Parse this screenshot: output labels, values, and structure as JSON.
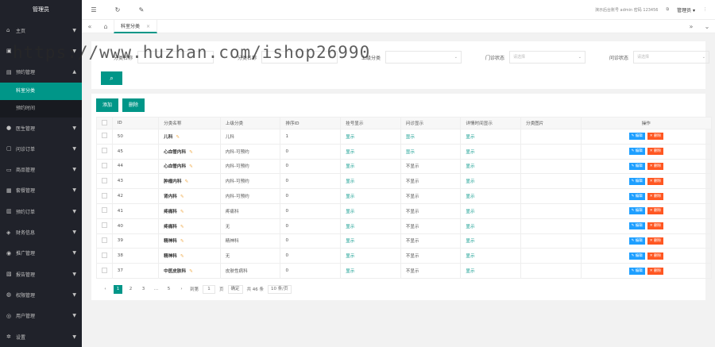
{
  "sidebar": {
    "logo": "管理员",
    "items": [
      {
        "label": "主页",
        "icon": "home-icon"
      },
      {
        "label": "",
        "icon": "app-icon"
      },
      {
        "label": "预约管理",
        "icon": "doc-icon",
        "expanded": true,
        "sub": [
          {
            "label": "科室分类",
            "active": true
          },
          {
            "label": "预约时间",
            "active": false
          }
        ]
      },
      {
        "label": "医生管理",
        "icon": "user-icon"
      },
      {
        "label": "问诊订单",
        "icon": "order-icon"
      },
      {
        "label": "商品管理",
        "icon": "goods-icon"
      },
      {
        "label": "套餐管理",
        "icon": "package-icon"
      },
      {
        "label": "预约订单",
        "icon": "calendar-icon"
      },
      {
        "label": "财务信息",
        "icon": "money-icon"
      },
      {
        "label": "推广管理",
        "icon": "share-icon"
      },
      {
        "label": "报告管理",
        "icon": "report-icon"
      },
      {
        "label": "权限管理",
        "icon": "lock-icon"
      },
      {
        "label": "用户管理",
        "icon": "users-icon"
      },
      {
        "label": "设置",
        "icon": "gear-icon"
      }
    ]
  },
  "header": {
    "icons": [
      "menu-icon",
      "refresh-icon",
      "broom-icon"
    ],
    "notice": "演示后台账号 admin 密码 123456",
    "user": "管理员"
  },
  "tabs": {
    "current": "科室分类"
  },
  "search": {
    "fields": [
      {
        "label": "分类名称",
        "placeholder": ""
      },
      {
        "label": "分类名称",
        "placeholder": ""
      },
      {
        "label": "上级分类",
        "placeholder": ""
      },
      {
        "label": "门诊状态",
        "placeholder": "请选择"
      },
      {
        "label": "问诊状态",
        "placeholder": "请选择"
      }
    ]
  },
  "toolbar": {
    "add": "添加",
    "delete": "删除"
  },
  "table": {
    "headers": [
      "ID",
      "分类名称",
      "上级分类",
      "排序ID",
      "挂号显示",
      "问诊显示",
      "详情时间显示",
      "分类图片",
      "操作"
    ],
    "edit_label": "编辑",
    "delete_label": "删除",
    "rows": [
      {
        "id": "50",
        "name": "儿科",
        "parent": "儿科",
        "sort": "1",
        "reg": "显示",
        "consult": "显示",
        "detail": "显示"
      },
      {
        "id": "45",
        "name": "心血管内科",
        "parent": "内科-可预约",
        "sort": "0",
        "reg": "显示",
        "consult": "显示",
        "detail": "显示"
      },
      {
        "id": "44",
        "name": "心血管内科",
        "parent": "内科-可预约",
        "sort": "0",
        "reg": "显示",
        "consult": "不显示",
        "detail": "显示"
      },
      {
        "id": "43",
        "name": "肿瘤内科",
        "parent": "内科-可预约",
        "sort": "0",
        "reg": "显示",
        "consult": "不显示",
        "detail": "显示"
      },
      {
        "id": "42",
        "name": "肾内科",
        "parent": "内科-可预约",
        "sort": "0",
        "reg": "显示",
        "consult": "不显示",
        "detail": "显示"
      },
      {
        "id": "41",
        "name": "疼痛科",
        "parent": "疼痛科",
        "sort": "0",
        "reg": "显示",
        "consult": "不显示",
        "detail": "显示"
      },
      {
        "id": "40",
        "name": "疼痛科",
        "parent": "无",
        "sort": "0",
        "reg": "显示",
        "consult": "不显示",
        "detail": "显示"
      },
      {
        "id": "39",
        "name": "精神科",
        "parent": "精神科",
        "sort": "0",
        "reg": "显示",
        "consult": "不显示",
        "detail": "显示"
      },
      {
        "id": "38",
        "name": "精神科",
        "parent": "无",
        "sort": "0",
        "reg": "显示",
        "consult": "不显示",
        "detail": "显示"
      },
      {
        "id": "37",
        "name": "中医皮肤科",
        "parent": "皮肤性病科",
        "sort": "0",
        "reg": "显示",
        "consult": "不显示",
        "detail": "显示"
      }
    ]
  },
  "pager": {
    "pages": [
      "1",
      "2",
      "3",
      "...",
      "5"
    ],
    "goto_label": "到第",
    "goto_value": "1",
    "page_unit": "页",
    "confirm": "确定",
    "total": "共 46 条",
    "per_page": "10 条/页"
  },
  "watermark": "https://www.huzhan.com/ishop26990",
  "colors": {
    "primary": "#009688",
    "edit": "#1e9fff",
    "delete": "#ff5722",
    "sidebar": "#20222a"
  }
}
